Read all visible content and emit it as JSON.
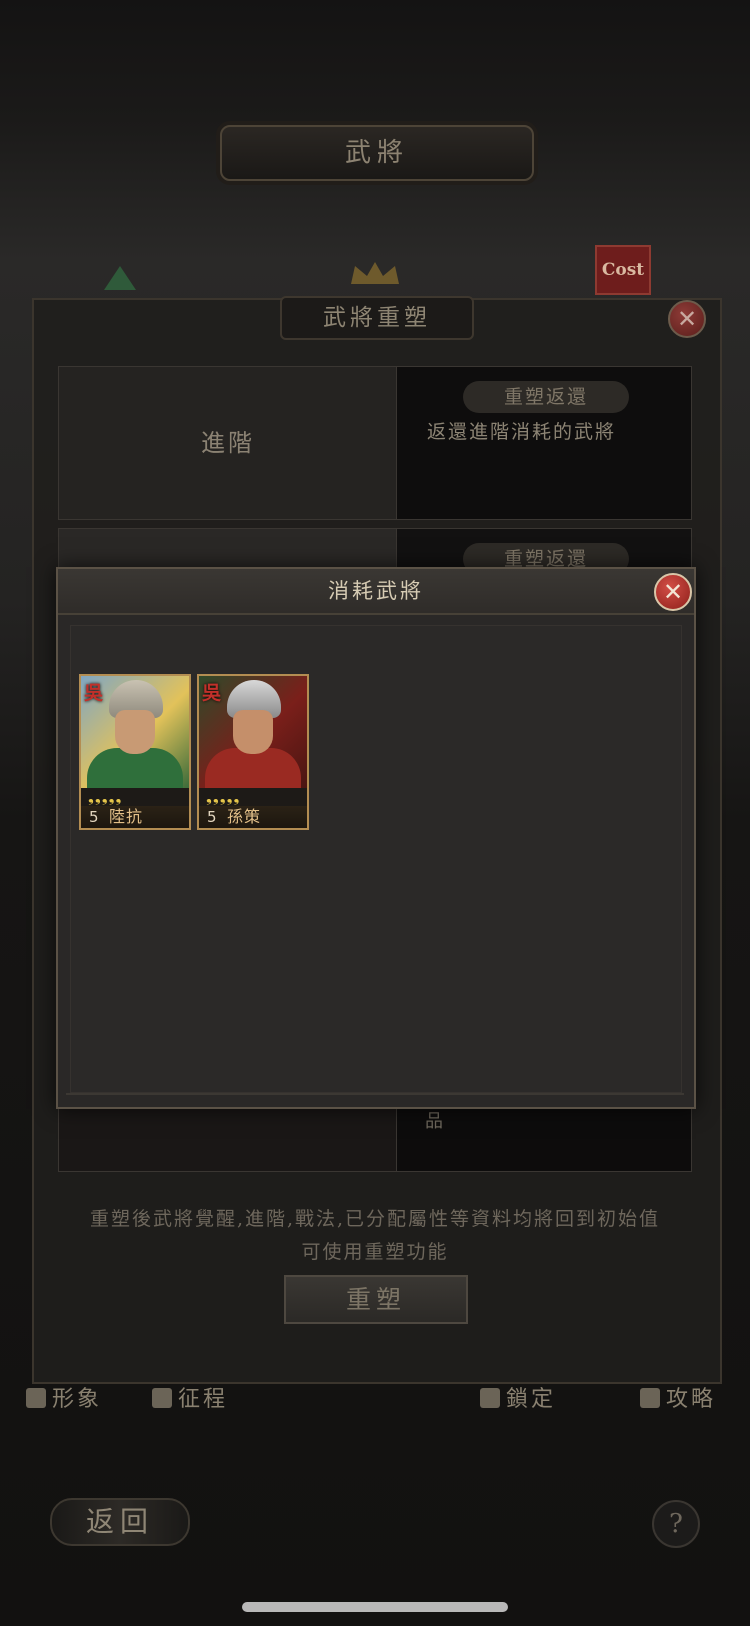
{
  "header": {
    "title": "武將",
    "cost_label": "Cost"
  },
  "reforge_panel": {
    "title": "武將重塑",
    "rows": [
      {
        "left_label": "進階",
        "badge": "重塑返還",
        "description": "返還進階消耗的武將"
      },
      {
        "left_label": "",
        "badge": "重塑返還",
        "description": ""
      }
    ],
    "partial_text": "品",
    "note_lines": [
      "重塑後武將覺醒,進階,戰法,已分配屬性等資料均將回到初始值",
      "可使用重塑功能"
    ],
    "button_label": "重塑"
  },
  "bottom_tabs": [
    {
      "label": "形象",
      "icon": "person-icon"
    },
    {
      "label": "征程",
      "icon": "flag-icon"
    },
    {
      "label": "鎖定",
      "icon": "lock-icon"
    },
    {
      "label": "攻略",
      "icon": "book-icon"
    }
  ],
  "footer": {
    "back_label": "返回",
    "help_label": "?"
  },
  "modal": {
    "title": "消耗武將",
    "cards": [
      {
        "faction": "吳",
        "stars": "❟❟❟❟❟",
        "star_count": 5,
        "cost": "5",
        "name": "陸抗"
      },
      {
        "faction": "吳",
        "stars": "❟❟❟❟❟",
        "star_count": 5,
        "cost": "5",
        "name": "孫策"
      }
    ]
  },
  "colors": {
    "accent_gold": "#b38d52",
    "close_red": "#c0392b",
    "star_yellow": "#e6c64a"
  }
}
